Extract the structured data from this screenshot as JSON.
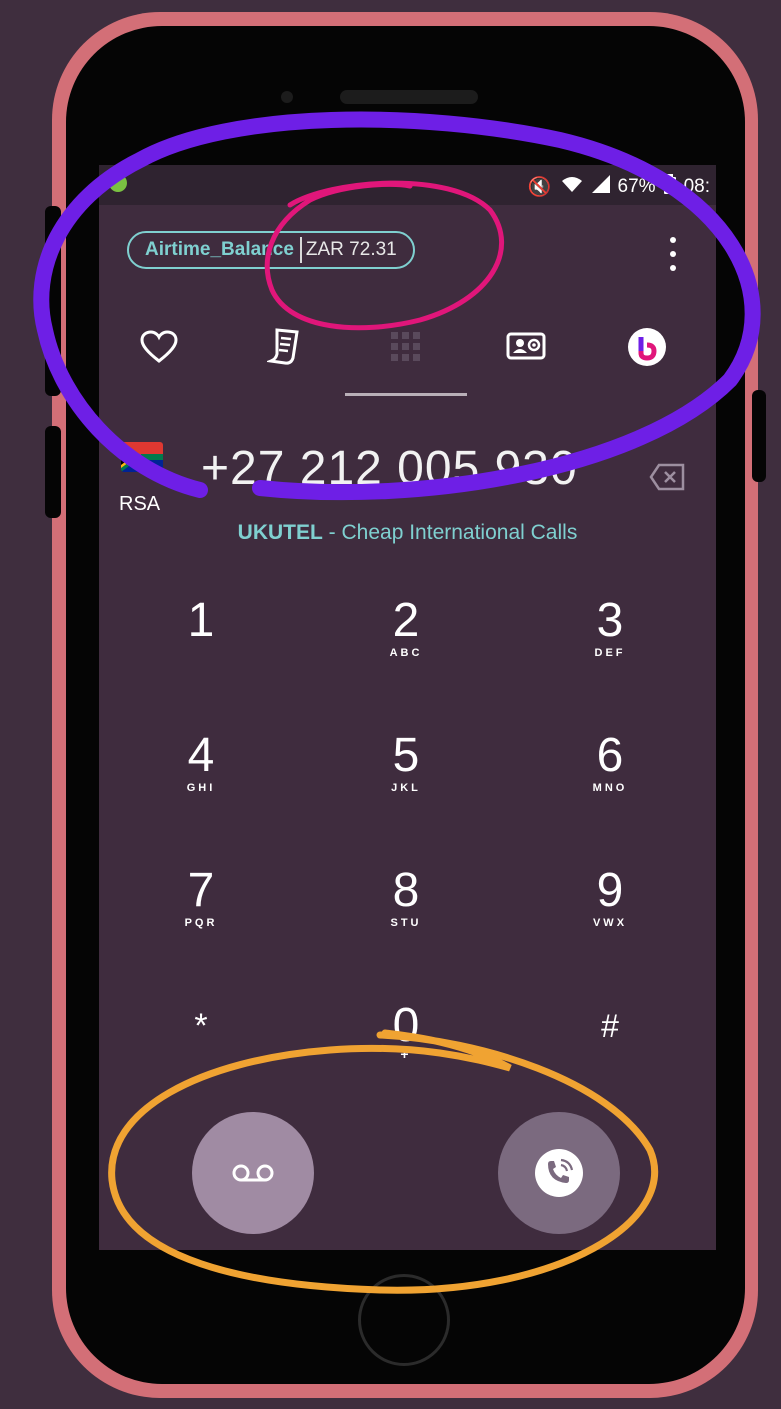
{
  "status_bar": {
    "battery": "67%",
    "time": "08:"
  },
  "balance": {
    "label": "Airtime_Balance",
    "value": "ZAR 72.31"
  },
  "tabs": [
    {
      "icon": "heart-icon"
    },
    {
      "icon": "call-log-icon"
    },
    {
      "icon": "dialpad-icon",
      "selected": true
    },
    {
      "icon": "contacts-icon"
    },
    {
      "icon": "ukutel-logo-icon"
    }
  ],
  "dialer": {
    "country": "RSA",
    "number": "+27 212 005 930",
    "provider_name": "UKUTEL",
    "provider_tagline": " - Cheap International Calls"
  },
  "keypad": [
    {
      "digit": "1",
      "letters": ""
    },
    {
      "digit": "2",
      "letters": "ABC"
    },
    {
      "digit": "3",
      "letters": "DEF"
    },
    {
      "digit": "4",
      "letters": "GHI"
    },
    {
      "digit": "5",
      "letters": "JKL"
    },
    {
      "digit": "6",
      "letters": "MNO"
    },
    {
      "digit": "7",
      "letters": "PQR"
    },
    {
      "digit": "8",
      "letters": "STU"
    },
    {
      "digit": "9",
      "letters": "VWX"
    },
    {
      "digit": "*",
      "letters": ""
    },
    {
      "digit": "0",
      "letters": "+"
    },
    {
      "digit": "#",
      "letters": ""
    }
  ],
  "colors": {
    "accent": "#7fd0d0",
    "voicemail_button": "#a08ba3",
    "call_button": "#7b6a7f",
    "annotation_purple": "#6e1fe6",
    "annotation_pink": "#e0167a",
    "annotation_orange": "#f0a332",
    "frame": "#d36f77"
  }
}
